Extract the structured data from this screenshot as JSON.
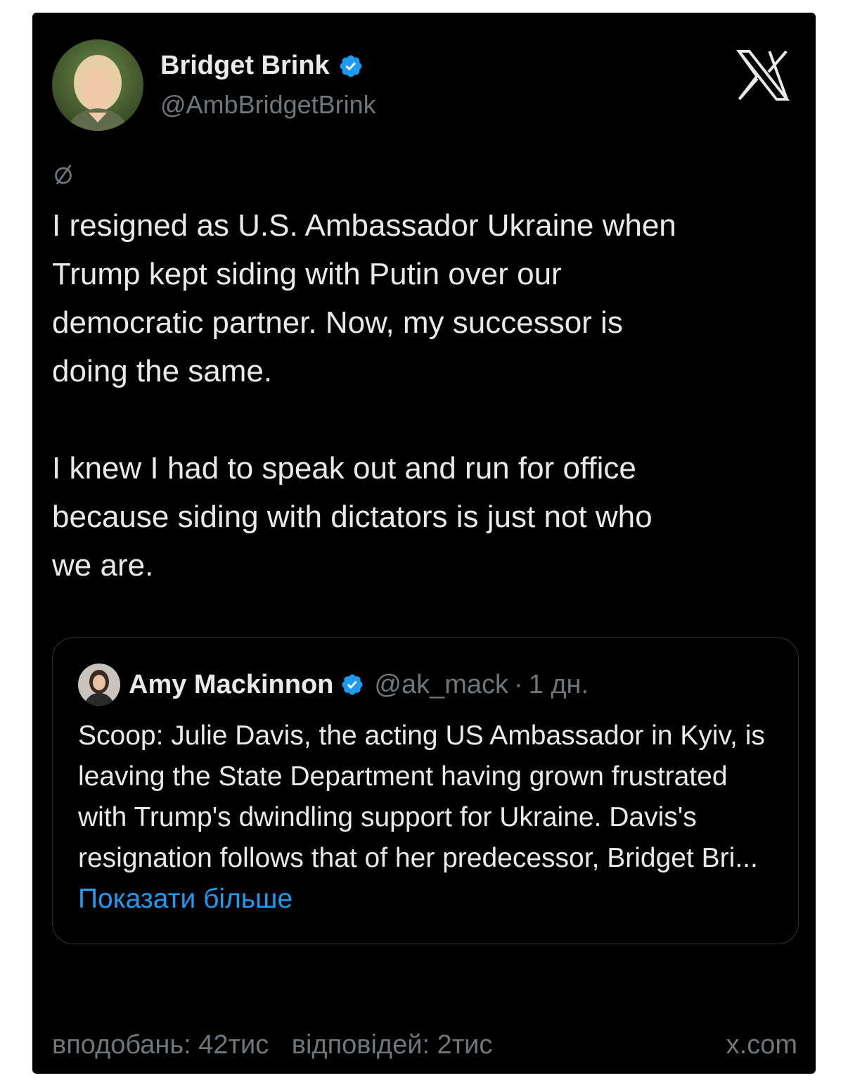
{
  "tweet": {
    "author": {
      "name": "Bridget Brink",
      "handle": "@AmbBridgetBrink"
    },
    "text": "I resigned as U.S. Ambassador Ukraine when\nTrump kept siding with Putin over our\ndemocratic partner. Now, my successor is\ndoing the same.\n\nI knew I had to speak out and run for office\nbecause siding with dictators is just not who\nwe are."
  },
  "quote": {
    "author": {
      "name": "Amy Mackinnon",
      "handle": "@ak_mack",
      "separator": "·",
      "time": "1 дн."
    },
    "text": "Scoop: Julie Davis, the acting US Ambassador in Kyiv, is leaving the State Department having grown frustrated with Trump's dwindling support for Ukraine. Davis's resignation follows that of her predecessor, Bridget Bri...",
    "show_more": "Показати більше"
  },
  "footer": {
    "likes": "вподобань: 42тис",
    "replies": "відповідей: 2тис",
    "domain": "x.com"
  },
  "icons": {
    "verified": "verified-badge-icon",
    "logo": "x-logo-icon",
    "grok": "grok-icon"
  },
  "colors": {
    "background": "#000000",
    "text": "#e7e9ea",
    "muted": "#71767b",
    "link": "#1d9bf0",
    "verified": "#1d9bf0"
  }
}
